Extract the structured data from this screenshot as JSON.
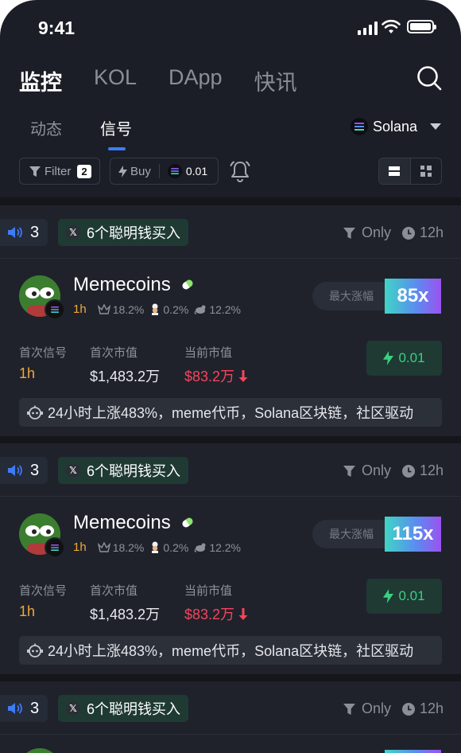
{
  "status": {
    "time": "9:41"
  },
  "main_tabs": [
    {
      "label": "监控",
      "active": true
    },
    {
      "label": "KOL",
      "active": false
    },
    {
      "label": "DApp",
      "active": false
    },
    {
      "label": "快讯",
      "active": false
    }
  ],
  "sub_tabs": [
    {
      "label": "动态",
      "active": false
    },
    {
      "label": "信号",
      "active": true
    }
  ],
  "chain": {
    "label": "Solana"
  },
  "toolbar": {
    "filter_label": "Filter",
    "filter_count": "2",
    "buy_label": "Buy",
    "buy_amount": "0.01"
  },
  "colors": {
    "bg": "#1b1e26",
    "accent": "#3e7bf5",
    "up_green": "#3ccf84",
    "down_red": "#f4455d",
    "age_orange": "#f0a93a"
  },
  "cards": [
    {
      "alerts": "3",
      "smart_money": "6个聪明钱买入",
      "only": "Only",
      "window": "12h",
      "token": "Memecoins",
      "age": "1h",
      "stats": [
        "18.2%",
        "0.2%",
        "12.2%"
      ],
      "max_label": "最大涨幅",
      "max_value": "85x",
      "first_signal_label": "首次信号",
      "first_signal": "1h",
      "first_mc_label": "首次市值",
      "first_mc": "$1,483.2万",
      "current_mc_label": "当前市值",
      "current_mc": "$83.2万",
      "quick_buy": "0.01",
      "description": "24小时上涨483%，meme代币，Solana区块链，社区驱动"
    },
    {
      "alerts": "3",
      "smart_money": "6个聪明钱买入",
      "only": "Only",
      "window": "12h",
      "token": "Memecoins",
      "age": "1h",
      "stats": [
        "18.2%",
        "0.2%",
        "12.2%"
      ],
      "max_label": "最大涨幅",
      "max_value": "115x",
      "first_signal_label": "首次信号",
      "first_signal": "1h",
      "first_mc_label": "首次市值",
      "first_mc": "$1,483.2万",
      "current_mc_label": "当前市值",
      "current_mc": "$83.2万",
      "quick_buy": "0.01",
      "description": "24小时上涨483%，meme代币，Solana区块链，社区驱动"
    },
    {
      "alerts": "3",
      "smart_money": "6个聪明钱买入",
      "only": "Only",
      "window": "12h"
    }
  ]
}
